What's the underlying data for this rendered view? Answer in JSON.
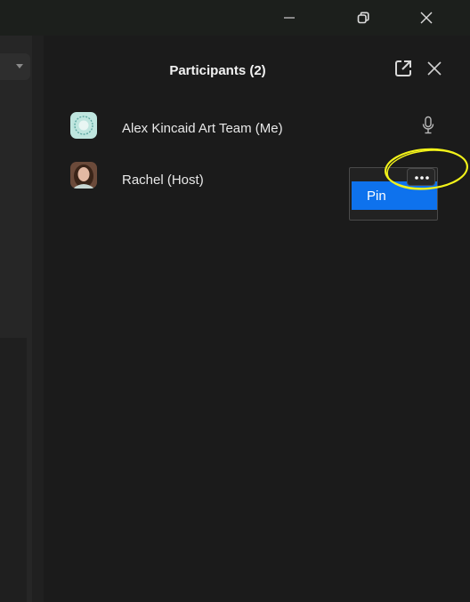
{
  "panel": {
    "title": "Participants (2)"
  },
  "participants": [
    {
      "name": "Alex Kincaid Art Team (Me)",
      "avatar_icon": "circular-logo-avatar",
      "mic_icon": "microphone-icon"
    },
    {
      "name": "Rachel (Host)",
      "avatar_icon": "photo-avatar"
    }
  ],
  "context_menu": {
    "items": [
      "Pin"
    ]
  },
  "colors": {
    "accent": "#0e72ed",
    "highlight": "#f2f21a",
    "background": "#1b1b1b"
  }
}
